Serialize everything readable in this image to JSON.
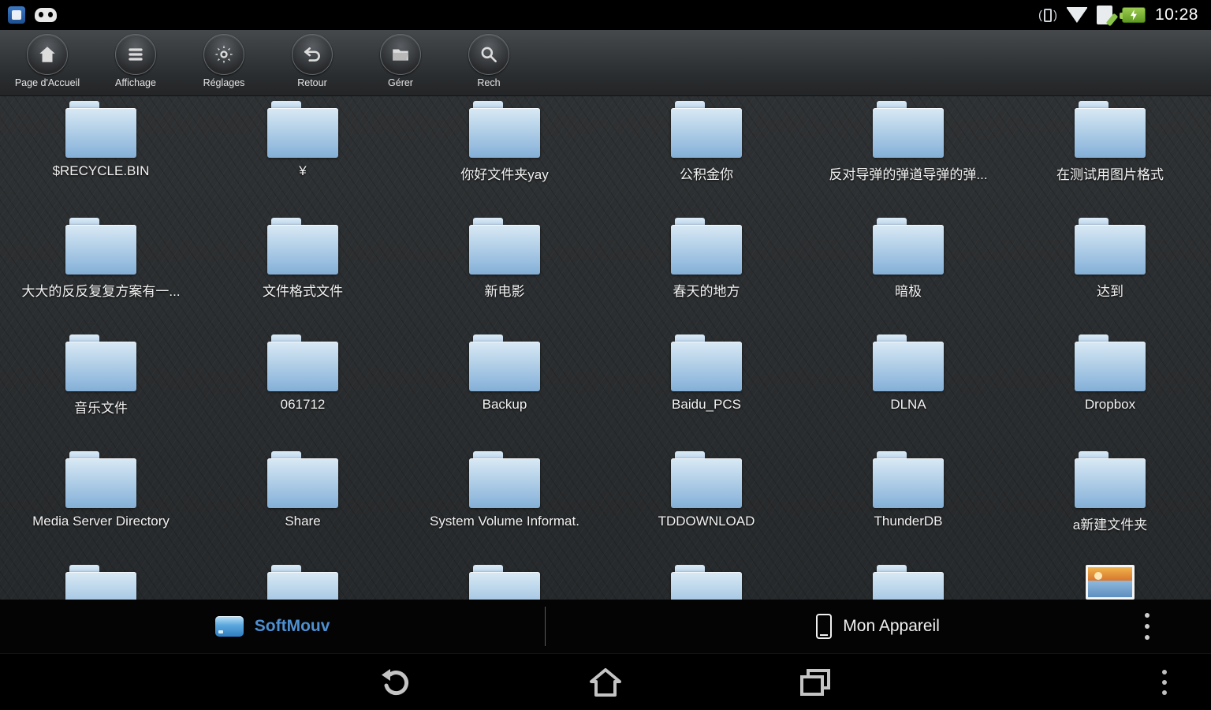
{
  "status_bar": {
    "time": "10:28",
    "left_icons": [
      "app-notification-icon",
      "mask-notification-icon"
    ],
    "right_icons": [
      "vibrate-icon",
      "wifi-icon",
      "sd-write-icon",
      "battery-charging-icon"
    ]
  },
  "toolbar": {
    "buttons": [
      {
        "label": "Page d'Accueil",
        "icon": "home-icon"
      },
      {
        "label": "Affichage",
        "icon": "list-icon"
      },
      {
        "label": "Réglages",
        "icon": "gear-icon"
      },
      {
        "label": "Retour",
        "icon": "back-icon"
      },
      {
        "label": "Gérer",
        "icon": "folder-icon"
      },
      {
        "label": "Rech",
        "icon": "search-icon"
      }
    ]
  },
  "content": {
    "folders": [
      "$RECYCLE.BIN",
      "¥",
      "你好文件夹yay",
      "公积金你",
      "反对导弹的弹道导弹的弹...",
      "在测试用图片格式",
      "大大的反反复复方案有一...",
      "文件格式文件",
      "新电影",
      "春天的地方",
      "暗极",
      "达到",
      "音乐文件",
      "061712",
      "Backup",
      "Baidu_PCS",
      "DLNA",
      "Dropbox",
      "Media Server Directory",
      "Share",
      "System Volume Informat.",
      "TDDOWNLOAD",
      "ThunderDB",
      "a新建文件夹"
    ],
    "partial_row": [
      "folder",
      "folder",
      "folder",
      "folder",
      "folder",
      "image"
    ]
  },
  "tabs": {
    "left": {
      "label": "SoftMouv",
      "icon": "drive-icon"
    },
    "right": {
      "label": "Mon Appareil",
      "icon": "phone-icon"
    }
  },
  "nav_bar": {
    "icons": [
      "back-icon",
      "home-icon",
      "recents-icon",
      "menu-icon"
    ]
  },
  "colors": {
    "accent_blue": "#4d8fd0",
    "folder_blue": "#b6d2e9",
    "battery_green": "#8bc34a",
    "background": "#2a2d2f"
  }
}
